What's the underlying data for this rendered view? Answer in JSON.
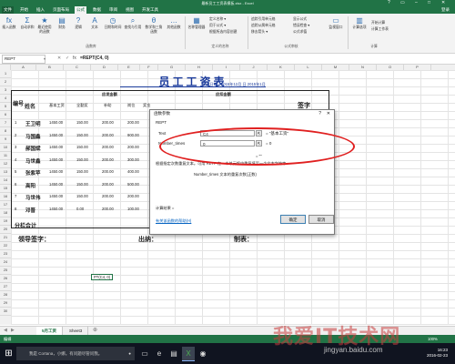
{
  "window": {
    "title": "最新员工工资表模板.xlsx - Excel",
    "sign_in": "登录"
  },
  "tabs": [
    "文件",
    "开始",
    "插入",
    "页面布局",
    "公式",
    "数据",
    "审阅",
    "视图",
    "开发工具"
  ],
  "ribbon": {
    "buttons": [
      {
        "label": "插入函数",
        "icon": "fx"
      },
      {
        "label": "自动求和",
        "icon": "Σ"
      },
      {
        "label": "最近使用的函数",
        "icon": "★"
      },
      {
        "label": "财务",
        "icon": "▤"
      },
      {
        "label": "逻辑",
        "icon": "?"
      },
      {
        "label": "文本",
        "icon": "A"
      },
      {
        "label": "日期和时间",
        "icon": "◷"
      },
      {
        "label": "查找与引用",
        "icon": "⌕"
      },
      {
        "label": "数学和三角函数",
        "icon": "θ"
      },
      {
        "label": "其他函数",
        "icon": "…"
      },
      {
        "label": "名称管理器",
        "icon": "▦"
      },
      {
        "label": "计算选项",
        "icon": "▥"
      }
    ],
    "small": [
      "定义名称 ▾",
      "用于公式 ▾",
      "根据所选内容创建",
      "追踪引用单元格",
      "追踪从属单元格",
      "移去箭头 ▾",
      "显示公式",
      "错误检查 ▾",
      "公式求值",
      "监视窗口",
      "开始计算",
      "计算工作表"
    ],
    "groups": [
      "函数库",
      "定义的名称",
      "公式审核",
      "计算"
    ]
  },
  "formula_bar": {
    "name_box": "REPT",
    "fx": "fx",
    "formula": "=REPT(C4, 0)"
  },
  "columns": [
    "A",
    "B",
    "C",
    "D",
    "E",
    "F",
    "G",
    "H",
    "I",
    "J",
    "K",
    "L",
    "M",
    "N",
    "O",
    "P"
  ],
  "rows": [
    "1",
    "2",
    "3",
    "4",
    "5",
    "6",
    "7",
    "8",
    "9",
    "10",
    "11",
    "12",
    "13",
    "14",
    "15",
    "16",
    "17",
    "18",
    "19",
    "20",
    "21",
    "22",
    "23",
    "24",
    "25",
    "26",
    "27",
    "28",
    "29",
    "30"
  ],
  "sheet": {
    "title": "员工工资表",
    "date_text": "发放日期：2015年12月  日    2015年1月",
    "group_headers": [
      "应发金额",
      "应扣金额"
    ],
    "col_headers": [
      "编号",
      "姓名",
      "基本工资",
      "全勤奖",
      "补助",
      "岗位",
      "奖金"
    ],
    "signature_header": "签字",
    "employees": [
      {
        "no": "1",
        "name": "王卫明",
        "base": "1450.00",
        "a": "150.00",
        "b": "200.00",
        "c": "200.00"
      },
      {
        "no": "2",
        "name": "马国鑫",
        "base": "1450.00",
        "a": "150.00",
        "b": "200.00",
        "c": "900.00"
      },
      {
        "no": "3",
        "name": "郝国斌",
        "base": "1450.00",
        "a": "150.00",
        "b": "200.00",
        "c": "200.00"
      },
      {
        "no": "4",
        "name": "马世鑫",
        "base": "1450.00",
        "a": "150.00",
        "b": "200.00",
        "c": "300.00"
      },
      {
        "no": "5",
        "name": "张紫苹",
        "base": "1450.00",
        "a": "150.00",
        "b": "200.00",
        "c": "400.00"
      },
      {
        "no": "6",
        "name": "高阳",
        "base": "1450.00",
        "a": "150.00",
        "b": "200.00",
        "c": "500.00"
      },
      {
        "no": "7",
        "name": "马世伟",
        "base": "1450.00",
        "a": "150.00",
        "b": "200.00",
        "c": "200.00"
      },
      {
        "no": "8",
        "name": "邓晋",
        "base": "1450.00",
        "a": "0.00",
        "b": "200.00",
        "c": "100.00"
      }
    ],
    "total_label": "分栏合计",
    "footer": {
      "leader": "领导签字：",
      "cashier": "出纳：",
      "maker": "制表："
    },
    "active_cell_text": "PT(C4, 0)"
  },
  "dialog": {
    "title": "函数参数",
    "function": "REPT",
    "args": [
      {
        "label": "Text",
        "value": "C4",
        "result": "= \"基本工资\""
      },
      {
        "label": "Number_times",
        "value": "0",
        "result": "= 0"
      }
    ],
    "result_preview": "= \"\"",
    "description": "根据指定次数重复文本。可用 RETP 在一个单元格中重复填写一个文本字符串",
    "arg_description": "Number_times  文本的重复次数(正数)",
    "calc_result": "计算结果 =",
    "help_link": "有关该函数的帮助(H)",
    "ok": "确定",
    "cancel": "取消"
  },
  "sheet_tabs": [
    "5月工资",
    "Sheet3"
  ],
  "status": {
    "mode": "编辑",
    "zoom": "100%"
  },
  "taskbar": {
    "search": "我是 Cortana，小娜。有问题尽管问我。",
    "time": "16:23",
    "date": "2016-02-23"
  },
  "watermark": {
    "text": "我爱IT技术网",
    "url": "jingyan.baidu.com"
  }
}
